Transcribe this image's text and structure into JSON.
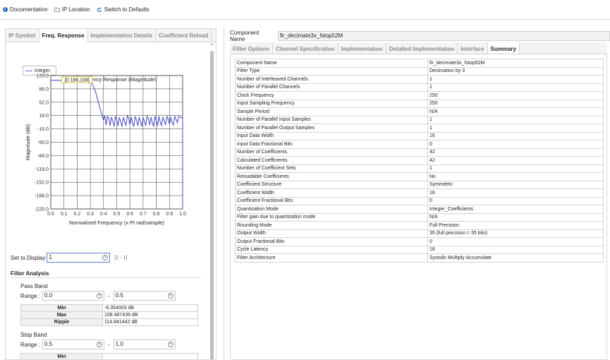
{
  "toolbar": {
    "documentation": "Documentation",
    "ip_location": "IP Location",
    "switch_defaults": "Switch to Defaults"
  },
  "left_tabs": [
    "IP Symbol",
    "Freq. Response",
    "Implementation Details",
    "Coefficient Reload"
  ],
  "left_active_tab": "Freq. Response",
  "legend": "Integer.",
  "chart_data": {
    "type": "line",
    "title": "Frequency Response (Magnitude)",
    "xlabel": "Normalized Frequency (x PI rad/sample)",
    "ylabel": "Magnitude (dB)",
    "xlim": [
      0.0,
      1.0
    ],
    "ylim": [
      -220.0,
      120.0
    ],
    "x_ticks": [
      "0.0",
      "0.1",
      "0.2",
      "0.3",
      "0.4",
      "0.5",
      "0.6",
      "0.7",
      "0.8",
      "0.9",
      "1.0"
    ],
    "y_ticks": [
      "120.0",
      "86.0",
      "52.0",
      "18.0",
      "-16.0",
      "-50.0",
      "-84.0",
      "-118.0",
      "-152.0",
      "-186.0",
      "-220.0"
    ],
    "grid": true,
    "legend_position": "top-left",
    "series_color": "#4646c8",
    "series": [
      {
        "name": "Integer.",
        "x": [
          0.0,
          0.05,
          0.1,
          0.15,
          0.2,
          0.25,
          0.28,
          0.3,
          0.31,
          0.32,
          0.33,
          0.34,
          0.35,
          0.36,
          0.37,
          0.38,
          0.39,
          0.4,
          0.41,
          0.42,
          0.43,
          0.44,
          0.45,
          0.46,
          0.47,
          0.48,
          0.49,
          0.5,
          0.51,
          0.52,
          0.53,
          0.54,
          0.55,
          0.56,
          0.57,
          0.58,
          0.59,
          0.6,
          0.61,
          0.62,
          0.63,
          0.64,
          0.65,
          0.66,
          0.67,
          0.68,
          0.69,
          0.7,
          0.71,
          0.72,
          0.73,
          0.74,
          0.75,
          0.76,
          0.77,
          0.78,
          0.79,
          0.8,
          0.81,
          0.82,
          0.83,
          0.84,
          0.85,
          0.86,
          0.87,
          0.88,
          0.89,
          0.9,
          0.91,
          0.92,
          0.93,
          0.94,
          0.95,
          0.96,
          0.97,
          0.98,
          0.99,
          1.0,
          1.0
        ],
        "y": [
          108,
          108,
          108,
          108,
          108,
          107.5,
          106,
          104,
          100,
          95,
          87,
          78,
          66,
          52,
          40,
          28,
          18,
          6,
          18,
          -6,
          16,
          10,
          -8,
          14,
          4,
          -10,
          16,
          6,
          -8,
          14,
          2,
          -10,
          14,
          4,
          -8,
          18,
          12,
          -6,
          14,
          0,
          -10,
          16,
          6,
          -8,
          14,
          2,
          -10,
          14,
          4,
          -8,
          16,
          10,
          -6,
          14,
          0,
          -10,
          16,
          6,
          -8,
          16,
          2,
          -8,
          14,
          4,
          -6,
          16,
          10,
          -4,
          14,
          0,
          -6,
          16,
          8,
          0,
          16,
          14,
          12,
          14,
          -220
        ]
      }
    ],
    "annotations": [
      "[0.188,108]"
    ]
  },
  "set_display": {
    "label": "Set to Display",
    "value": "1",
    "range": "[1 - 1]"
  },
  "filter_analysis": {
    "title": "Filter Analysis",
    "pass_band": {
      "title": "Pass Band",
      "range_label": "Range :",
      "from": "0.0",
      "to": "0.5",
      "separator": "-",
      "rows": [
        {
          "k": "Min",
          "v": "-6.354003 dB"
        },
        {
          "k": "Max",
          "v": "108.487439 dB"
        },
        {
          "k": "Ripple",
          "v": "114.841442 dB"
        }
      ]
    },
    "stop_band": {
      "title": "Stop Band",
      "range_label": "Range :",
      "from": "0.5",
      "to": "1.0",
      "separator": "-",
      "rows": [
        {
          "k": "Min",
          "v": ""
        }
      ]
    }
  },
  "component_name": {
    "label": "Component Name",
    "value": "fir_decimate3x_fstop52M"
  },
  "right_tabs": [
    "Filter Options",
    "Channel Specification",
    "Implementation",
    "Detailed Implementation",
    "Interface",
    "Summary"
  ],
  "right_active_tab": "Summary",
  "summary": [
    [
      "Component Name",
      "fir_decimate3x_fstop52M"
    ],
    [
      "Filter Type",
      "Decimation by 3"
    ],
    [
      "Number of Interleaved Channels",
      "1"
    ],
    [
      "Number of Parallel Channels",
      "1"
    ],
    [
      "Clock Frequency",
      "250"
    ],
    [
      "Input Sampling Frequency",
      "250"
    ],
    [
      "Sample Period",
      "N/A"
    ],
    [
      "Number of Parallel Input Samples",
      "1"
    ],
    [
      "Number of Parallel Output Samples",
      "1"
    ],
    [
      "Input Data Width",
      "16"
    ],
    [
      "Input Data Fractional Bits",
      "0"
    ],
    [
      "Number of Coefficients",
      "42"
    ],
    [
      "Calculated Coefficients",
      "42"
    ],
    [
      "Number of Coefficient Sets",
      "1"
    ],
    [
      "Reloadable Coefficients",
      "No"
    ],
    [
      "Coefficient Structure",
      "Symmetric"
    ],
    [
      "Coefficient Width",
      "18"
    ],
    [
      "Coefficient Fractional Bits",
      "0"
    ],
    [
      "Quantization Mode",
      "Integer_Coefficients"
    ],
    [
      "Filter gain due to quantization mode",
      "N/A"
    ],
    [
      "Rounding Mode",
      "Full Precision"
    ],
    [
      "Output Width",
      "35 (full precision = 35 bits)"
    ],
    [
      "Output Fractional Bits",
      "0"
    ],
    [
      "Cycle Latency",
      "18"
    ],
    [
      "Filter Architecture",
      "Systolic Multiply Accumulate"
    ]
  ]
}
